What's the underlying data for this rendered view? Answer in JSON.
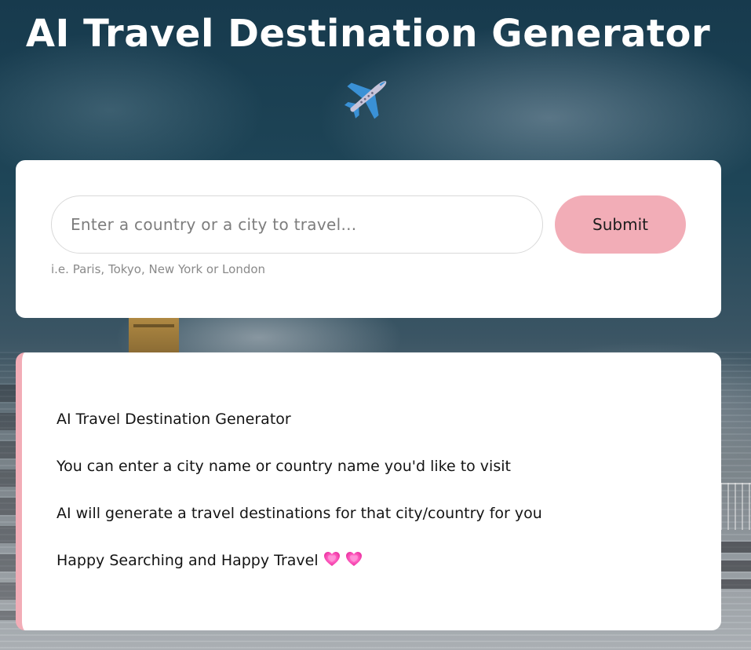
{
  "header": {
    "title": "AI Travel Destination Generator",
    "title_icon": "airplane-icon"
  },
  "search": {
    "placeholder": "Enter a country or a city to travel...",
    "value": "",
    "submit_label": "Submit",
    "hint": "i.e. Paris, Tokyo, New York or London"
  },
  "info": {
    "lines": [
      "AI Travel Destination Generator",
      "You can enter a city name or country name you'd like to visit",
      "AI will generate a travel destinations for that city/country for you",
      "Happy Searching and Happy Travel"
    ],
    "trailing_icons": [
      "sparkling-heart-icon",
      "sparkling-heart-icon"
    ]
  },
  "colors": {
    "accent": "#f2adb7",
    "card_background": "#ffffff",
    "title_text": "#ffffff",
    "body_text": "#141414",
    "hint_text": "#8a8a8a"
  }
}
